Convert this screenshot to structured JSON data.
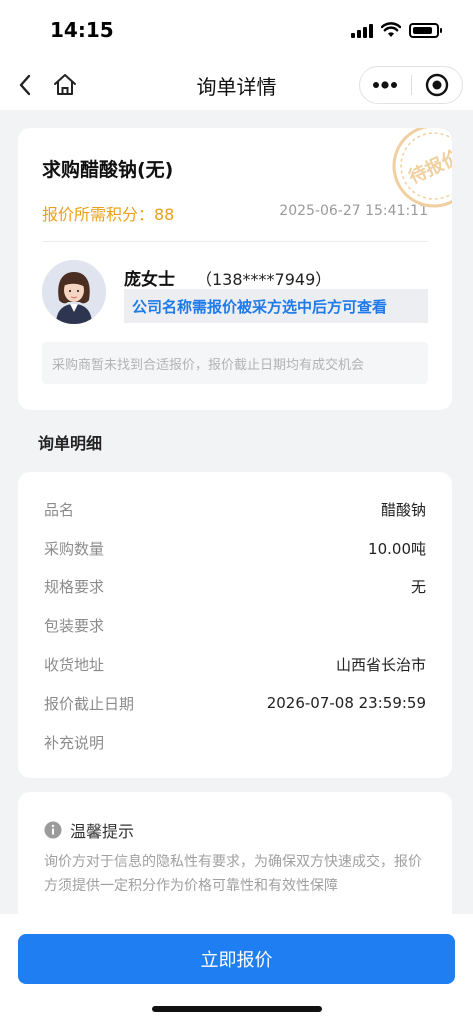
{
  "status_bar": {
    "time": "14:15"
  },
  "nav": {
    "title": "询单详情"
  },
  "inquiry": {
    "product_title": "求购醋酸钠(无)",
    "points_text": "报价所需积分：88",
    "datetime": "2025-06-27 15:41:11",
    "stamp_text": "待报价",
    "buyer_name": "庞女士",
    "buyer_phone": "（138****7949）",
    "company_notice": "公司名称需报价被采方选中后方可查看",
    "tip": "采购商暂未找到合适报价，报价截止日期均有成交机会"
  },
  "details": {
    "section_title": "询单明细",
    "rows": [
      {
        "label": "品名",
        "value": "醋酸钠"
      },
      {
        "label": "采购数量",
        "value": "10.00吨"
      },
      {
        "label": "规格要求",
        "value": "无"
      },
      {
        "label": "包装要求",
        "value": ""
      },
      {
        "label": "收货地址",
        "value": "山西省长治市"
      },
      {
        "label": "报价截止日期",
        "value": "2026-07-08 23:59:59"
      },
      {
        "label": "补充说明",
        "value": ""
      }
    ]
  },
  "warm_tip": {
    "title": "温馨提示",
    "text": "询价方对于信息的隐私性有要求，为确保双方快速成交，报价方须提供一定积分作为价格可靠性和有效性保障"
  },
  "bottom": {
    "button_label": "立即报价"
  },
  "colors": {
    "accent": "#1f7ff2",
    "points": "#e9a11a",
    "notice": "#1f7aea",
    "stamp": "#f0cfa0"
  }
}
